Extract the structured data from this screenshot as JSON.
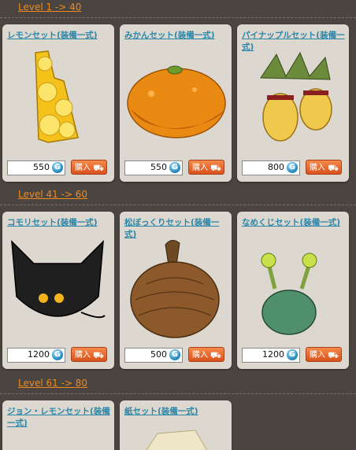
{
  "sections": [
    {
      "label": "Level 1 -> 40"
    },
    {
      "label": "Level 41 -> 60"
    },
    {
      "label": "Level 61 -> 80"
    }
  ],
  "items": [
    {
      "name": "レモンセット(装備一式)",
      "price": "550"
    },
    {
      "name": "みかんセット(装備一式)",
      "price": "550"
    },
    {
      "name": "パイナップルセット(装備一式)",
      "price": "800"
    },
    {
      "name": "コモリセット(装備一式)",
      "price": "1200"
    },
    {
      "name": "松ぼっくりセット(装備一式)",
      "price": "500"
    },
    {
      "name": "なめくじセット(装備一式)",
      "price": "1200"
    },
    {
      "name": "ジョン・レモンセット(装備一式)"
    },
    {
      "name": "紙セット(装備一式)"
    }
  ],
  "ui": {
    "buy_label": "購入",
    "cart_icon": "cart-icon",
    "currency_icon": "gold-coin-icon",
    "currency_glyph": "G"
  }
}
